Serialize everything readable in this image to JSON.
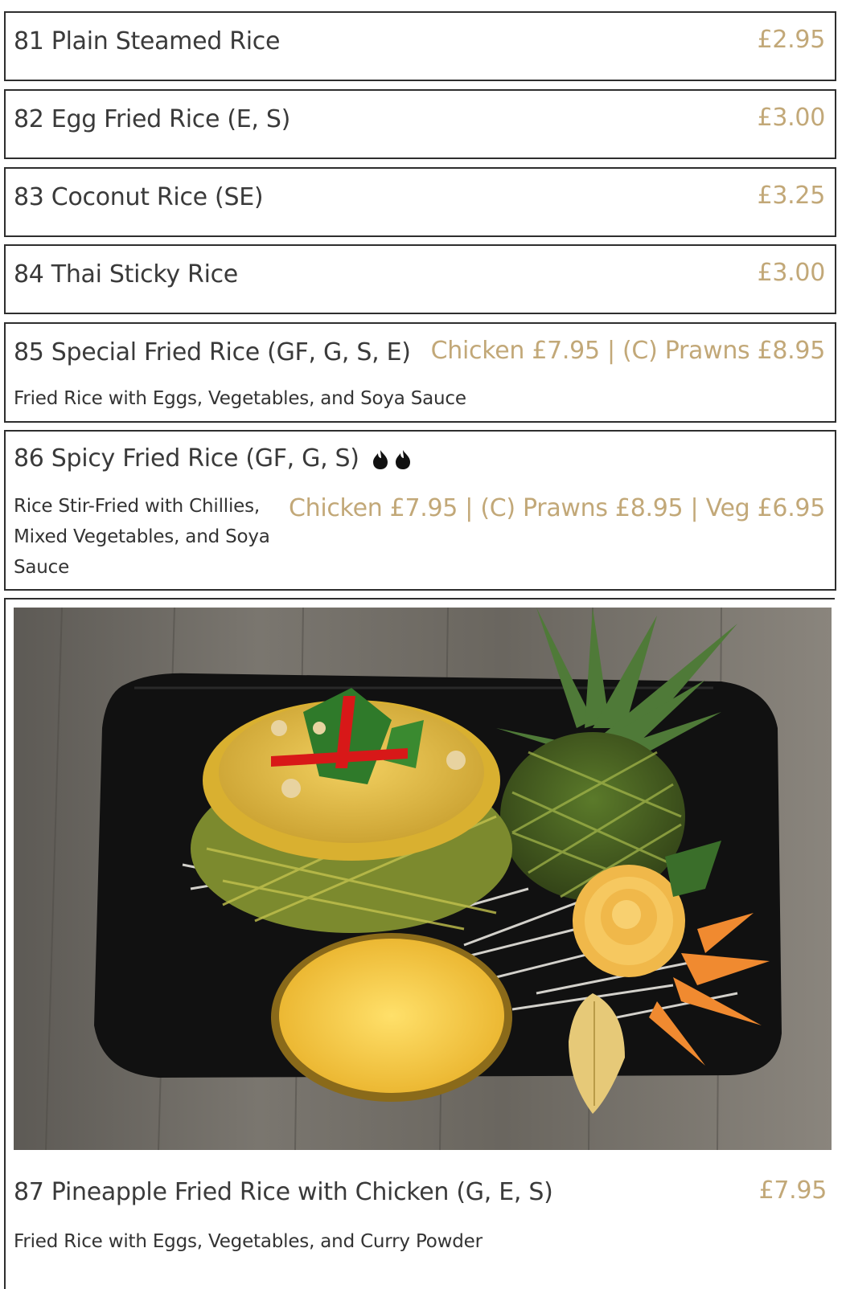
{
  "menu": {
    "items": [
      {
        "name": "81 Plain Steamed Rice",
        "price": "£2.95"
      },
      {
        "name": "82 Egg Fried Rice (E, S)",
        "price": "£3.00"
      },
      {
        "name": "83 Coconut Rice (SE)",
        "price": "£3.25"
      },
      {
        "name": "84 Thai Sticky Rice",
        "price": "£3.00"
      },
      {
        "name": "85 Special Fried Rice (GF, G, S, E)",
        "price": "Chicken £7.95 | (C) Prawns £8.95",
        "description": "Fried Rice with Eggs, Vegetables, and Soya Sauce"
      },
      {
        "name": "86 Spicy Fried Rice (GF, G, S)",
        "price": "Chicken £7.95 | (C) Prawns £8.95 | Veg £6.95",
        "description_lines": [
          "Rice Stir-Fried with Chillies,",
          "Mixed Vegetables, and Soya",
          "Sauce"
        ],
        "spice_icons": [
          "chili-icon",
          "chili-icon"
        ]
      },
      {
        "name": "87 Pineapple Fried Rice with Chicken (G, E, S)",
        "price": "£7.95",
        "description": "Fried Rice with Eggs, Vegetables, and Curry Powder",
        "image_icon": "pineapple-fried-rice-photo"
      }
    ]
  },
  "colors": {
    "price": "#c2a878",
    "border": "#2e2e2e",
    "text": "#333333"
  }
}
